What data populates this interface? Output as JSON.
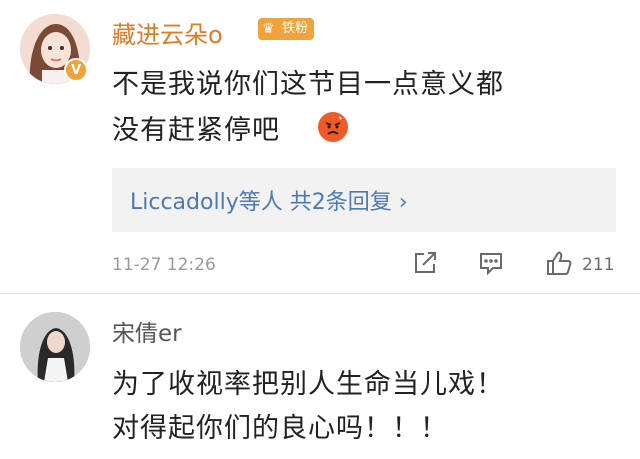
{
  "comments": [
    {
      "username": "藏进云朵o",
      "fan_badge": "铁粉",
      "verified_badge": "V",
      "text_line1": "不是我说你们这节目一点意义都",
      "text_line2": "没有赶紧停吧",
      "emoji": "angry-face-emoji",
      "replies": {
        "label": "Liccadolly等人 共2条回复 ›"
      },
      "timestamp": "11-27 12:26",
      "like_count": "211"
    },
    {
      "username": "宋倩er",
      "text_line1": "为了收视率把别人生命当儿戏！",
      "text_line2": "对得起你们的良心吗！！！"
    }
  ],
  "colors": {
    "username_accent": "#e07b27",
    "badge": "#f0a33b",
    "link_blue": "#4d79b5",
    "meta_gray": "#9a9a9a"
  }
}
